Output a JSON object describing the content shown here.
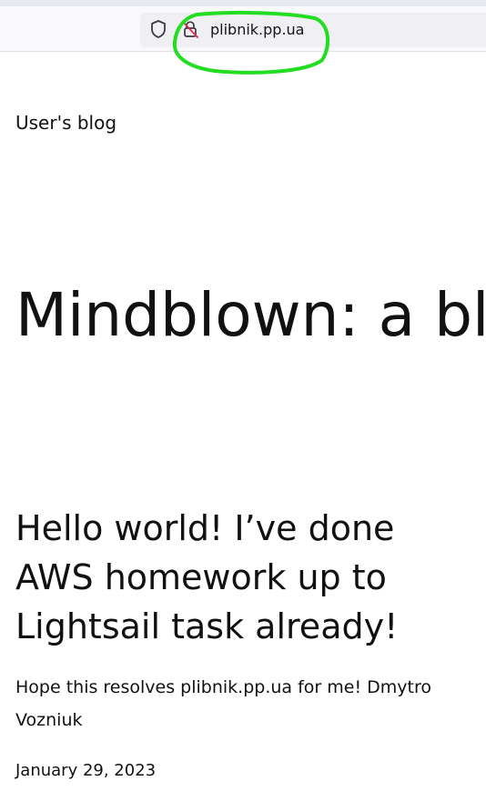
{
  "browser": {
    "url": "plibnik.pp.ua",
    "security_icon": "shield-icon",
    "lock_icon": "lock-slash-icon",
    "highlight_color": "#22dd22"
  },
  "site": {
    "title": "User's blog"
  },
  "page": {
    "heading": "Mindblown: a blog about philosophy."
  },
  "post": {
    "title": "Hello world! I’ve done AWS homework up to Lightsail task already!",
    "body": "Hope this resolves plibnik.pp.ua for me! Dmytro Vozniuk",
    "date": "January 29, 2023"
  }
}
